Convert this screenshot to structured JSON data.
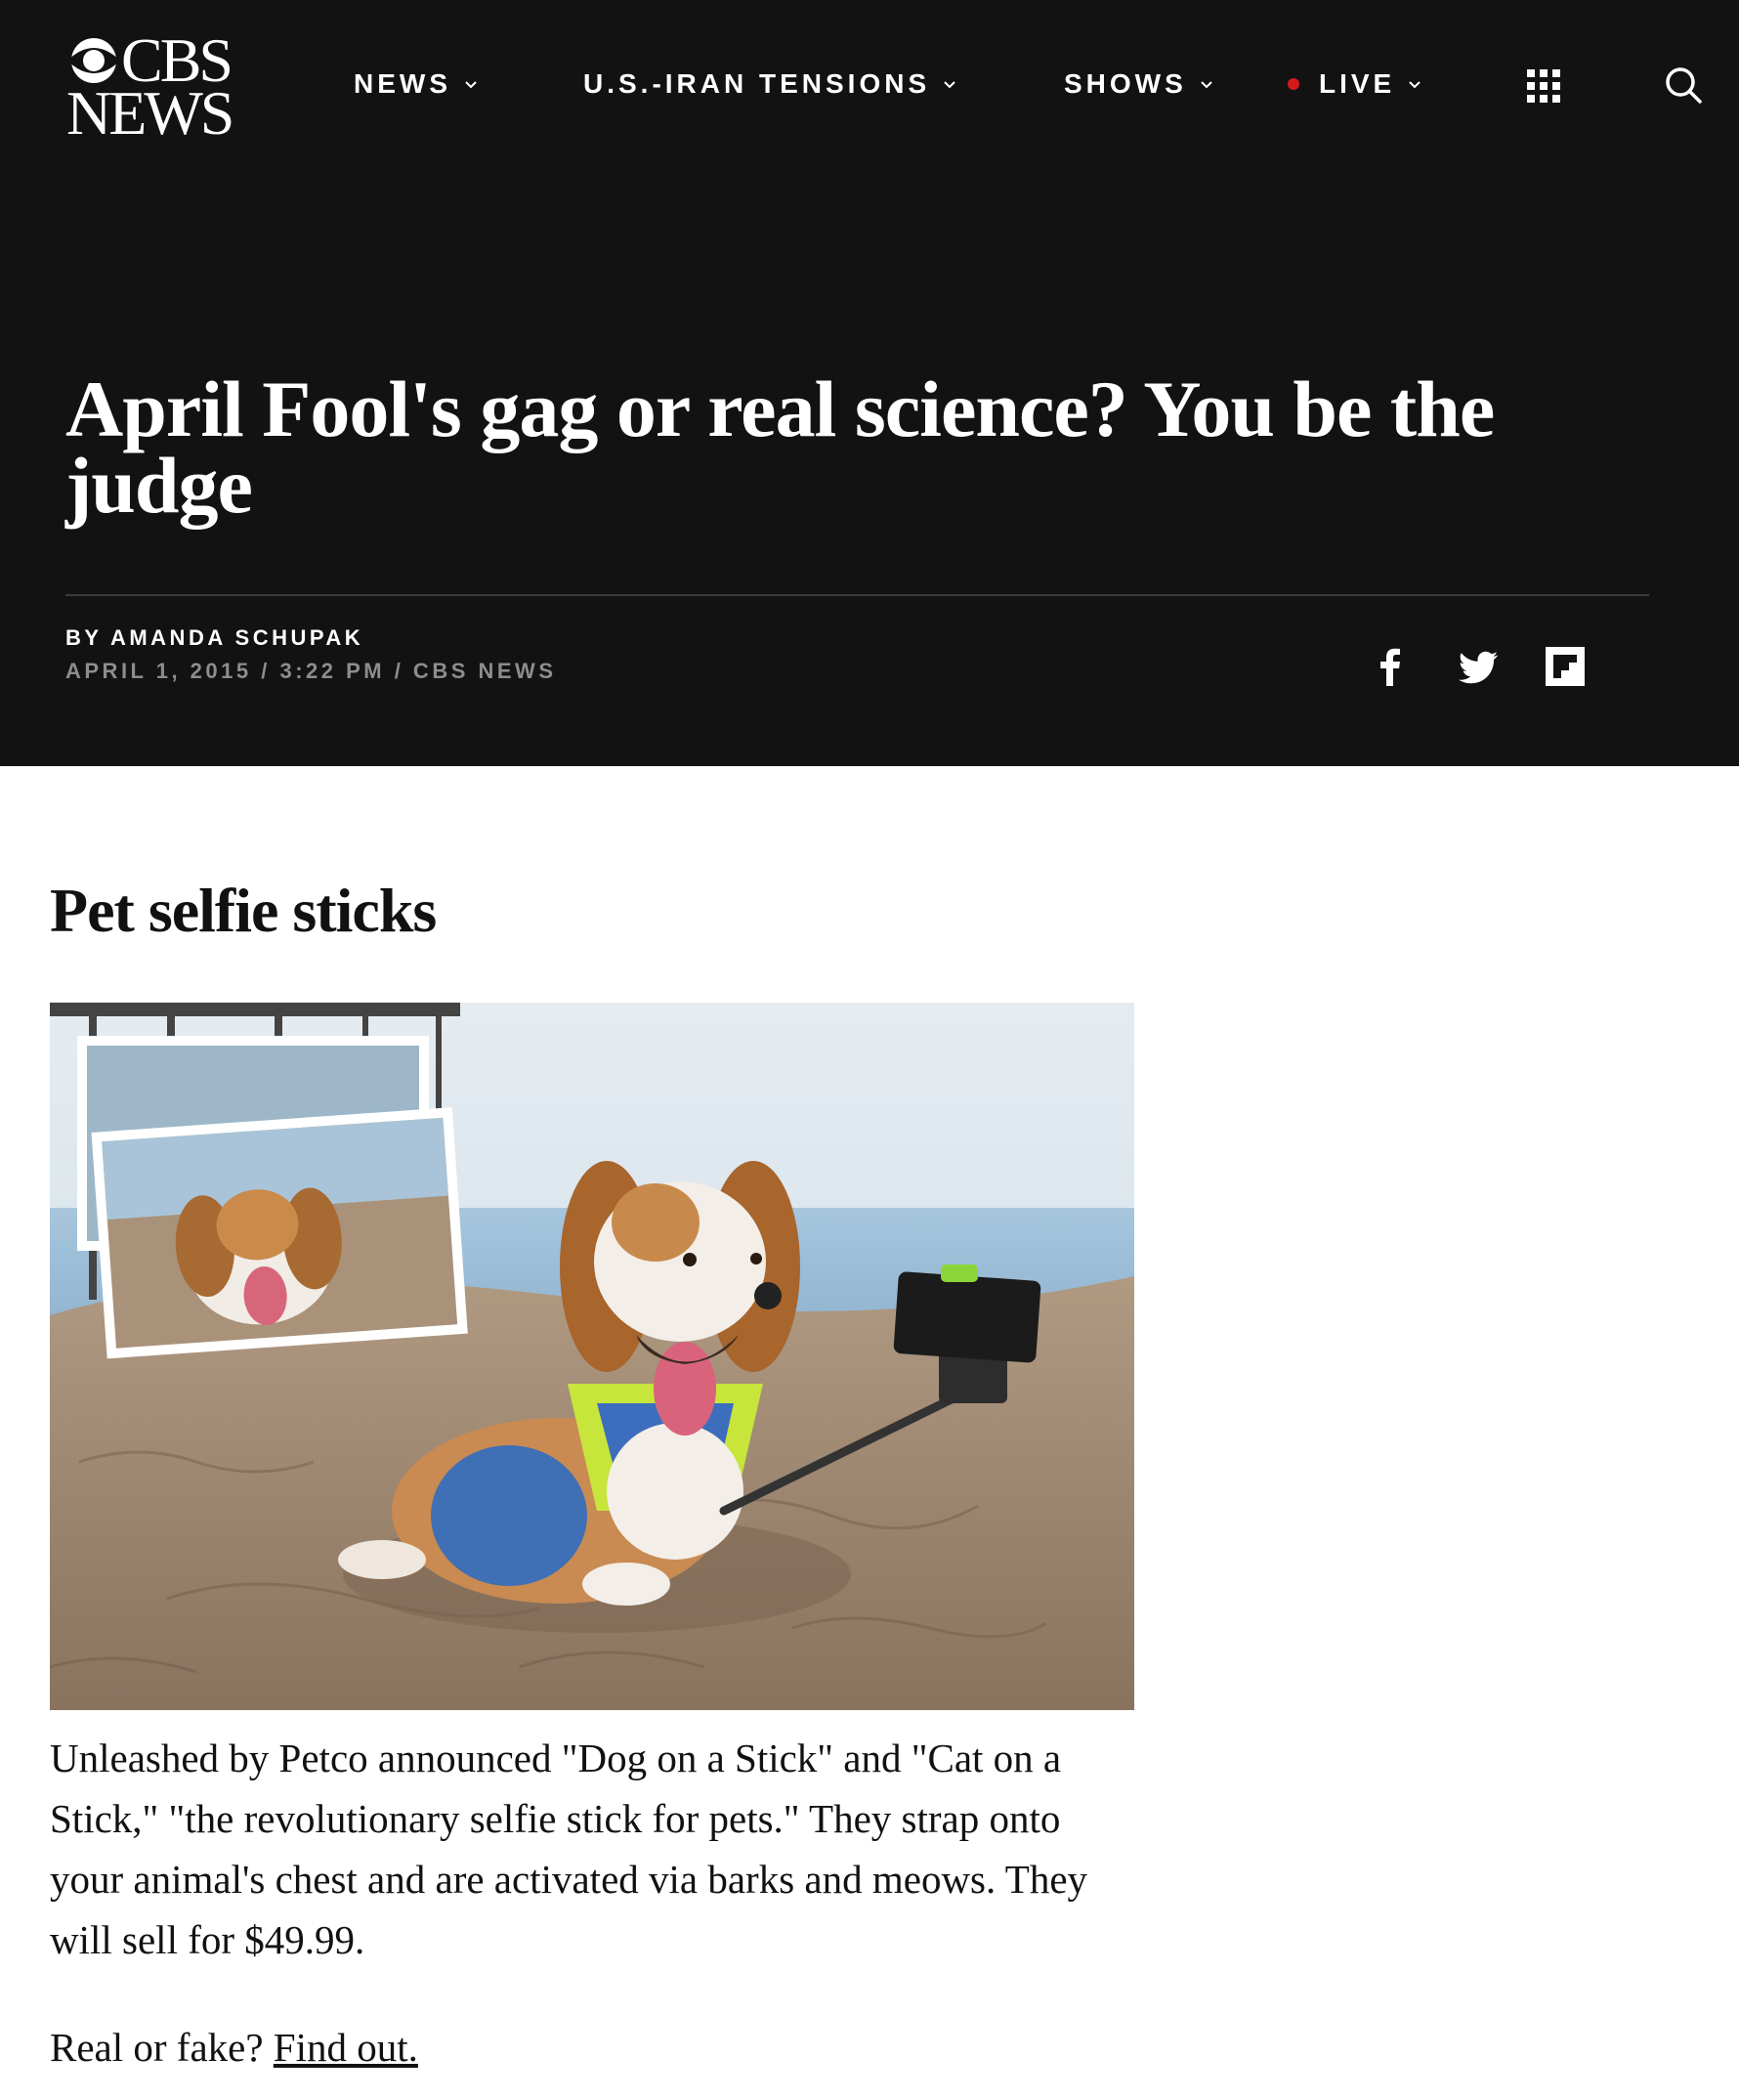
{
  "brand": {
    "line1": "CBS",
    "line2": "NEWS"
  },
  "nav": {
    "items": [
      {
        "label": "NEWS"
      },
      {
        "label": "U.S.-IRAN TENSIONS"
      },
      {
        "label": "SHOWS"
      },
      {
        "label": "LIVE"
      }
    ],
    "live_dot_color": "#d61a1a",
    "apps_icon": "grid-icon",
    "search_icon": "search-icon"
  },
  "article": {
    "headline": "April Fool's gag or real science? You be the judge",
    "byline": "BY AMANDA SCHUPAK",
    "dateline": "APRIL 1, 2015 / 3:22 PM / CBS NEWS",
    "share": [
      "facebook-icon",
      "twitter-icon",
      "flipboard-icon"
    ],
    "section_title": "Pet selfie sticks",
    "body": "Unleashed by Petco announced \"Dog on a Stick\" and \"Cat on a Stick,\" \"the revolutionary selfie stick for pets.\" They strap onto your animal's chest and are activated via barks and meows. They will sell for $49.99.",
    "real_or_fake_prefix": "Real or fake? ",
    "find_out_link": "Find out."
  },
  "colors": {
    "header_bg": "#121212",
    "divider": "#3b3b3b",
    "meta_gray": "#8d8d8d"
  }
}
